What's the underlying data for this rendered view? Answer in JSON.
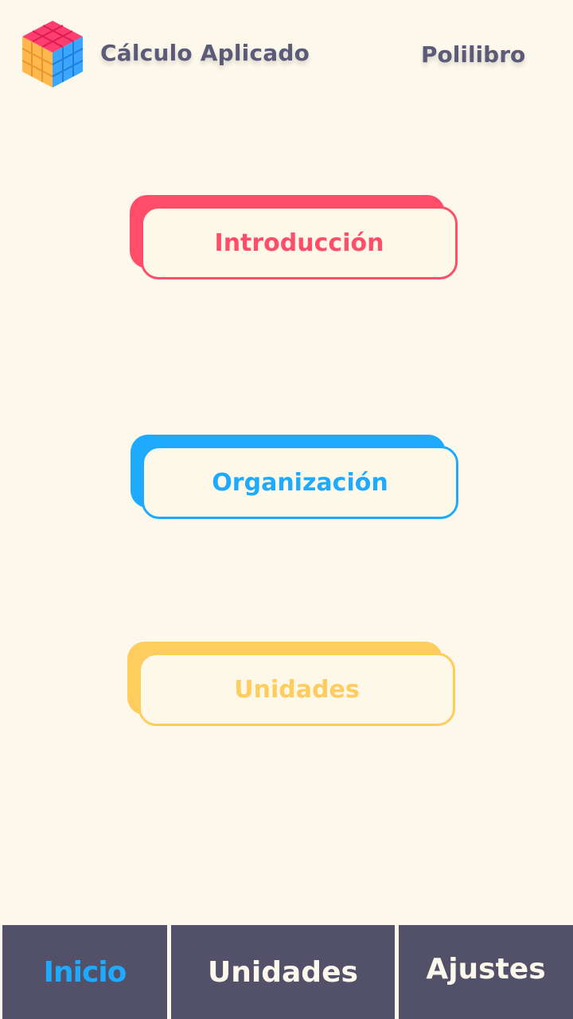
{
  "header": {
    "logo_icon": "rubiks-cube-icon",
    "title": "Cálculo Aplicado",
    "link_label": "Polilibro"
  },
  "menu": {
    "items": [
      {
        "label": "Introducción",
        "color": "#ff4d6a"
      },
      {
        "label": "Organización",
        "color": "#1eaaff"
      },
      {
        "label": "Unidades",
        "color": "#ffcc5e"
      }
    ]
  },
  "bottom_nav": {
    "items": [
      {
        "label": "Inicio",
        "active": true
      },
      {
        "label": "Unidades",
        "active": false
      },
      {
        "label": "Ajustes",
        "active": false
      }
    ],
    "background": "#535069",
    "active_color": "#1eaaff"
  },
  "colors": {
    "background": "#fdf8ec",
    "text_dark": "#5b5a78"
  }
}
